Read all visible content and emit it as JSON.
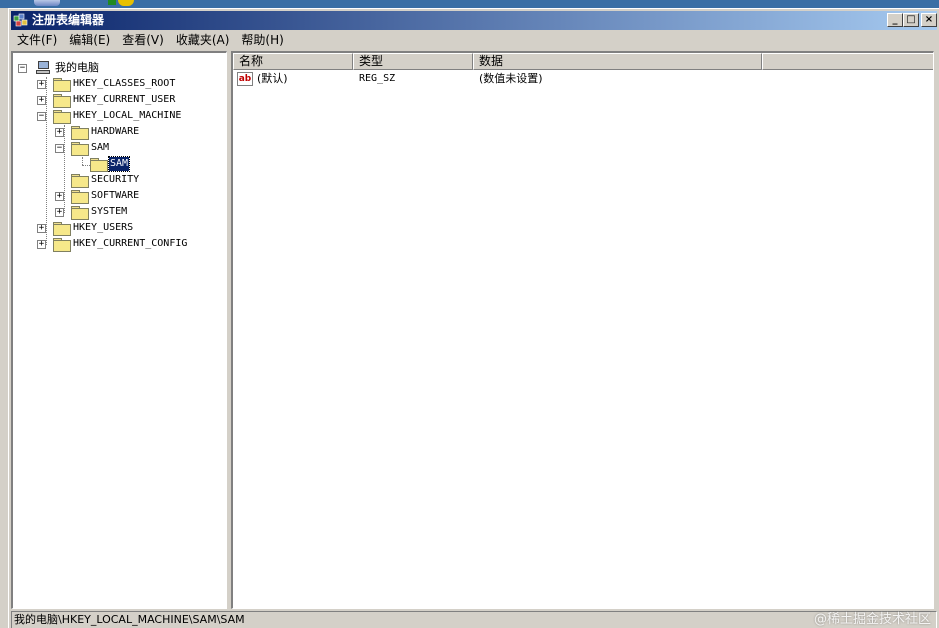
{
  "window": {
    "title": "注册表编辑器"
  },
  "menu": [
    "文件(F)",
    "编辑(E)",
    "查看(V)",
    "收藏夹(A)",
    "帮助(H)"
  ],
  "tree": {
    "root": "我的电脑",
    "hkcr": "HKEY_CLASSES_ROOT",
    "hkcu": "HKEY_CURRENT_USER",
    "hklm": "HKEY_LOCAL_MACHINE",
    "hardware": "HARDWARE",
    "sam": "SAM",
    "sam_sam": "SAM",
    "security": "SECURITY",
    "software": "SOFTWARE",
    "system": "SYSTEM",
    "hku": "HKEY_USERS",
    "hkcc": "HKEY_CURRENT_CONFIG",
    "expand_plus": "+",
    "expand_minus": "−"
  },
  "list": {
    "columns": [
      "名称",
      "类型",
      "数据"
    ],
    "rows": [
      {
        "icon": "ab",
        "name": "(默认)",
        "type": "REG_SZ",
        "data": "(数值未设置)"
      }
    ]
  },
  "status": {
    "path": "我的电脑\\HKEY_LOCAL_MACHINE\\SAM\\SAM"
  },
  "watermark": "@稀土掘金技术社区",
  "colors": {
    "titlebar_start": "#0a246a",
    "titlebar_end": "#a6caf0",
    "selection": "#0a246a",
    "face": "#d4d0c8"
  }
}
